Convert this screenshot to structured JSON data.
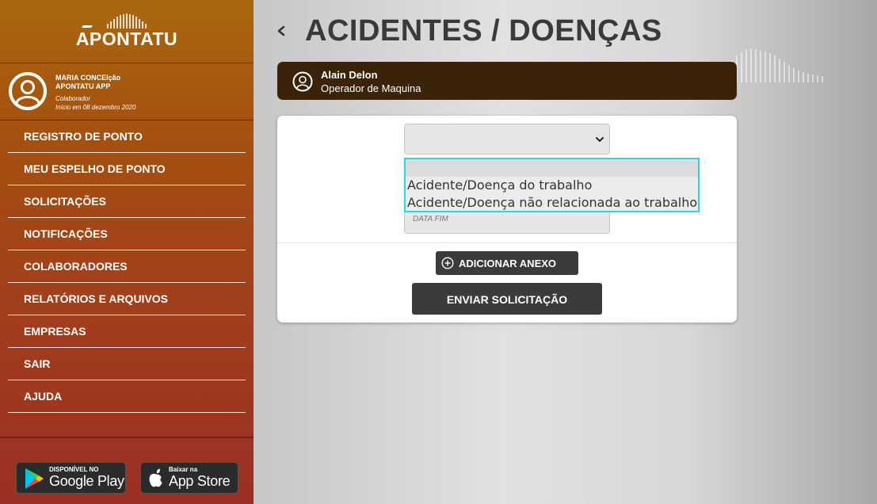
{
  "brand": {
    "name": "APONTATU"
  },
  "user": {
    "name": "MARIA CONCEIção",
    "company": "APONTATU APP",
    "role": "Colaborador",
    "since": "Início em 08 dezembro 2020"
  },
  "menu": {
    "items": [
      {
        "label": "REGISTRO DE PONTO"
      },
      {
        "label": "MEU ESPELHO DE PONTO"
      },
      {
        "label": "SOLICITAÇÕES"
      },
      {
        "label": "NOTIFICAÇÕES"
      },
      {
        "label": "COLABORADORES"
      },
      {
        "label": "RELATÓRIOS E ARQUIVOS"
      },
      {
        "label": "EMPRESAS"
      },
      {
        "label": "SAIR"
      },
      {
        "label": "AJUDA"
      }
    ]
  },
  "stores": {
    "google": {
      "small": "DISPONÍVEL NO",
      "big": "Google Play"
    },
    "apple": {
      "small": "Baixar na",
      "big": "App Store"
    }
  },
  "page": {
    "title": "ACIDENTES / DOENÇAS"
  },
  "person": {
    "name": "Alain Delon",
    "role": "Operador de Maquina"
  },
  "form": {
    "select_value": "",
    "options": [
      "",
      "Acidente/Doença do trabalho",
      "Acidente/Doença não relacionada ao trabalho"
    ],
    "date_end_placeholder": "DATA FIM",
    "attach_label": "ADICIONAR ANEXO",
    "send_label": "ENVIAR SOLICITAÇÃO"
  },
  "colors": {
    "sidebar_top": "#a9680e",
    "sidebar_bottom": "#9c2f24",
    "person_bar": "#3a2309",
    "button_dark": "#3b3b3b",
    "dropdown_focus": "#2bd7e6"
  },
  "icons": {
    "back": "chevron-left-icon",
    "avatar": "user-circle-icon",
    "select": "chevron-down-icon",
    "attach": "plus-circle-icon",
    "google": "google-play-icon",
    "apple": "apple-icon"
  }
}
